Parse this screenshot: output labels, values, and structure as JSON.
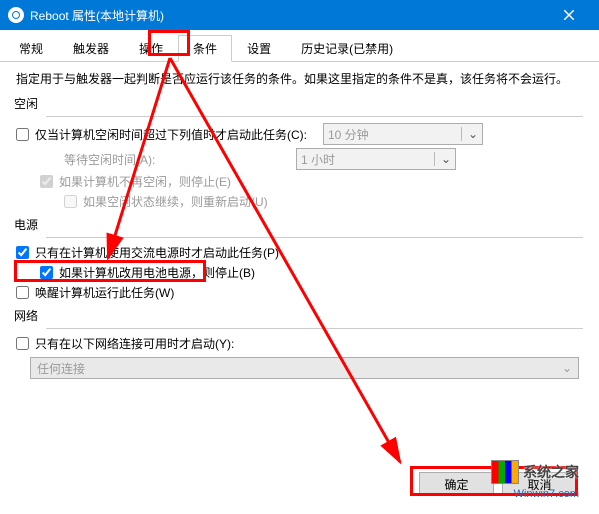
{
  "titlebar": {
    "title": "Reboot 属性(本地计算机)"
  },
  "tabs": {
    "items": [
      "常规",
      "触发器",
      "操作",
      "条件",
      "设置",
      "历史记录(已禁用)"
    ],
    "activeIndex": 3
  },
  "desc": "指定用于与触发器一起判断是否应运行该任务的条件。如果这里指定的条件不是真，该任务将不会运行。",
  "sections": {
    "idle": {
      "label": "空闲",
      "startOnIdle": {
        "label": "仅当计算机空闲时间超过下列值时才启动此任务(C):",
        "checked": false
      },
      "idleDuration": {
        "value": "10 分钟"
      },
      "waitLabel": "等待空闲时间(A):",
      "waitDuration": {
        "value": "1 小时"
      },
      "stopIfNotIdle": {
        "label": "如果计算机不再空闲，则停止(E)",
        "checked": true
      },
      "restartOnIdle": {
        "label": "如果空闲状态继续，则重新启动(U)",
        "checked": false
      }
    },
    "power": {
      "label": "电源",
      "acOnly": {
        "label": "只有在计算机使用交流电源时才启动此任务(P)",
        "checked": true
      },
      "stopOnBattery": {
        "label": "如果计算机改用电池电源，则停止(B)",
        "checked": true
      },
      "wakeToRun": {
        "label": "唤醒计算机运行此任务(W)",
        "checked": false
      }
    },
    "network": {
      "label": "网络",
      "onlyIfNetwork": {
        "label": "只有在以下网络连接可用时才启动(Y):",
        "checked": false
      },
      "connection": {
        "value": "任何连接"
      }
    }
  },
  "buttons": {
    "ok": "确定",
    "cancel": "取消"
  },
  "watermark": {
    "brand": "系统之家",
    "url": "Winwin7.com"
  }
}
